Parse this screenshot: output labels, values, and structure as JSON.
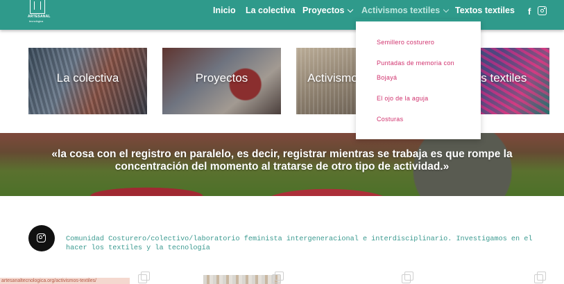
{
  "logo": {
    "name": "ARTESANAL",
    "sub": "tecnológica"
  },
  "nav": {
    "items": [
      "Inicio",
      "La colectiva",
      "Proyectos",
      "Activismos textiles",
      "Textos textiles"
    ],
    "facebook_icon": "facebook-icon",
    "instagram_icon": "instagram-icon"
  },
  "dropdown": {
    "items": [
      "Semillero costurero",
      "Puntadas de memoria con",
      "Bojayá",
      "El ojo de la aguja",
      "Costuras"
    ]
  },
  "cards": [
    {
      "label": "La colectiva"
    },
    {
      "label": "Proyectos"
    },
    {
      "label": "Activismos textiles"
    },
    {
      "label": "Textos textiles"
    }
  ],
  "quote": "«la cosa con el registro en paralelo, es decir, registrar mientras se trabaja es que rompe la concentración del momento al tratarse de otro tipo de actividad.»",
  "community": {
    "text": "Comunidad Costurero/colectivo/laboratorio feminista intergeneracional e interdisciplinario. Investigamos en el hacer los textiles y la tecnología"
  },
  "bottom_bar": {
    "text": "artesanaltecnologica.org/activismos-textiles/"
  },
  "colors": {
    "header": "#2f9a8b",
    "accent_pink": "#d0316d",
    "community_text": "#3b9a90"
  }
}
